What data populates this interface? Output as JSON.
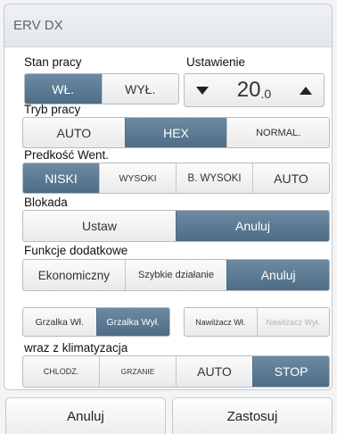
{
  "title": "ERV DX",
  "operation": {
    "label": "Stan pracy",
    "options": [
      "WŁ.",
      "WYŁ."
    ],
    "selected": "WŁ."
  },
  "setpoint": {
    "label": "Ustawienie",
    "value_int": "20",
    "value_dec": ".0",
    "down_icon": "triangle-down-icon",
    "up_icon": "triangle-up-icon"
  },
  "mode": {
    "label": "Tryb pracy",
    "options": [
      "AUTO",
      "HEX",
      "NORMAL."
    ],
    "selected": "HEX"
  },
  "fan_speed": {
    "label": "Predkość Went.",
    "options": [
      "NISKI",
      "WYSOKI",
      "B. WYSOKI",
      "AUTO"
    ],
    "selected": "NISKI"
  },
  "lock": {
    "label": "Blokada",
    "options": [
      "Ustaw",
      "Anuluj"
    ],
    "selected": "Anuluj"
  },
  "extra_functions": {
    "label": "Funkcje dodatkowe",
    "options": [
      "Ekonomiczny",
      "Szybkie działanie",
      "Anuluj"
    ],
    "selected": "Anuluj"
  },
  "heater": {
    "options": [
      "Grzalka Wł.",
      "Grzalka Wył."
    ],
    "selected": "Grzalka Wył."
  },
  "humidifier": {
    "options": [
      "Nawilżacz Wł.",
      "Nawilżacz Wył."
    ],
    "selected": "Nawilżacz Wł.",
    "disabled": "Nawilżacz Wył."
  },
  "with_ac": {
    "label": "wraz z klimatyzacja",
    "options": [
      "CHLODZ.",
      "GRZANIE",
      "AUTO",
      "STOP"
    ],
    "selected": "STOP"
  },
  "footer": {
    "cancel": "Anuluj",
    "apply": "Zastosuj"
  },
  "colors": {
    "active": "#5a7890",
    "background": "#ffffff",
    "title_text": "#5a6570"
  }
}
